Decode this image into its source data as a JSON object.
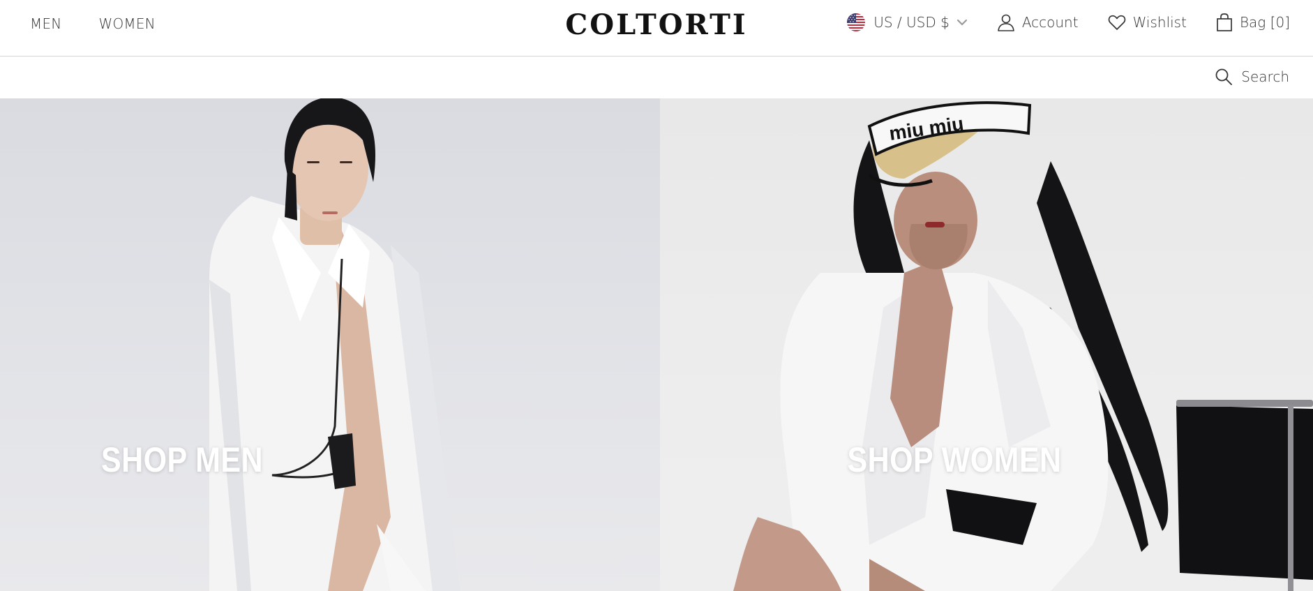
{
  "header": {
    "nav_left": [
      {
        "label": "MEN"
      },
      {
        "label": "WOMEN"
      }
    ],
    "logo": "COLTORTI",
    "locale": {
      "label": "US / USD $",
      "flag_icon": "us-flag-icon"
    },
    "account_label": "Account",
    "wishlist_label": "Wishlist",
    "bag_label": "Bag [0]"
  },
  "subbar": {
    "search_label": "Search"
  },
  "hero": {
    "men": {
      "cta": "SHOP MEN"
    },
    "women": {
      "cta": "SHOP WOMEN",
      "visor_text": "miu miu"
    }
  },
  "colors": {
    "text": "#333333",
    "divider": "#d4d4d4",
    "hero_men_bg": "#dcdee3",
    "hero_women_bg": "#ebebeb"
  }
}
